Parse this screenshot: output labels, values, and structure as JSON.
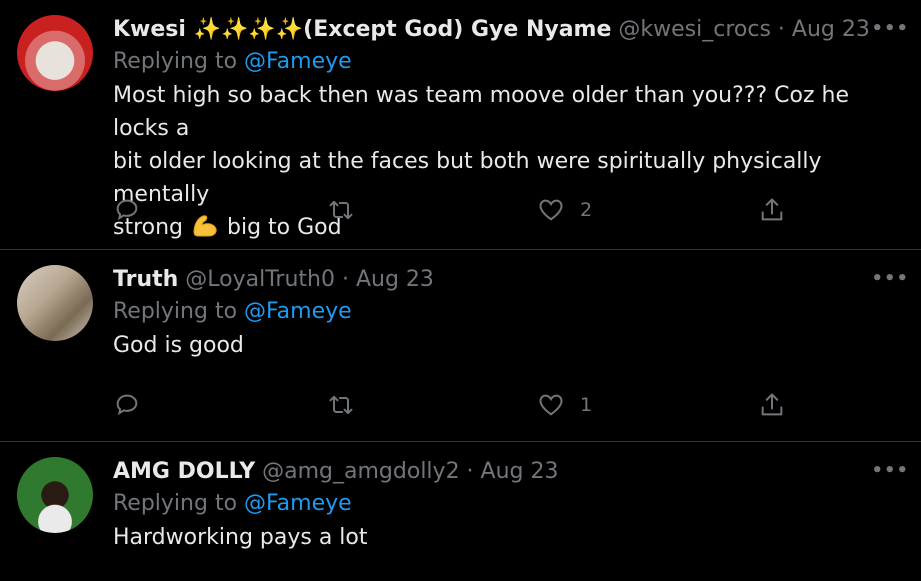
{
  "tweets": [
    {
      "name_prefix": "Kwesi ",
      "sparkles": "✨✨✨✨",
      "name_suffix": "(Except God) Gye Nyame",
      "handle": "@kwesi_crocs",
      "separator": " · ",
      "date": "Aug 23",
      "replying_label": "Replying to ",
      "replying_to": "@Fameye",
      "text_line1": "Most high so back then was team moove older than you??? Coz he locks a",
      "text_line2": "bit older looking at the faces but both were spiritually physically mentally",
      "text_line3_a": "strong ",
      "text_line3_b": " big to God",
      "emoji_icon": "flexed-biceps-icon",
      "reply_count": "",
      "retweet_count": "",
      "like_count": "2",
      "more": "•••"
    },
    {
      "name": "Truth",
      "handle": "@LoyalTruth0",
      "separator": " · ",
      "date": "Aug 23",
      "replying_label": "Replying to ",
      "replying_to": "@Fameye",
      "text": "God is good",
      "reply_count": "",
      "retweet_count": "",
      "like_count": "1",
      "more": "•••"
    },
    {
      "name": "AMG DOLLY",
      "handle": "@amg_amgdolly2",
      "separator": " · ",
      "date": "Aug 23",
      "replying_label": "Replying to ",
      "replying_to": "@Fameye",
      "text": "Hardworking pays a lot",
      "more": "•••"
    }
  ],
  "colors": {
    "background": "#000000",
    "text": "#e7e9ea",
    "muted": "#71767b",
    "link": "#1d9bf0",
    "divider": "#2f3336"
  }
}
